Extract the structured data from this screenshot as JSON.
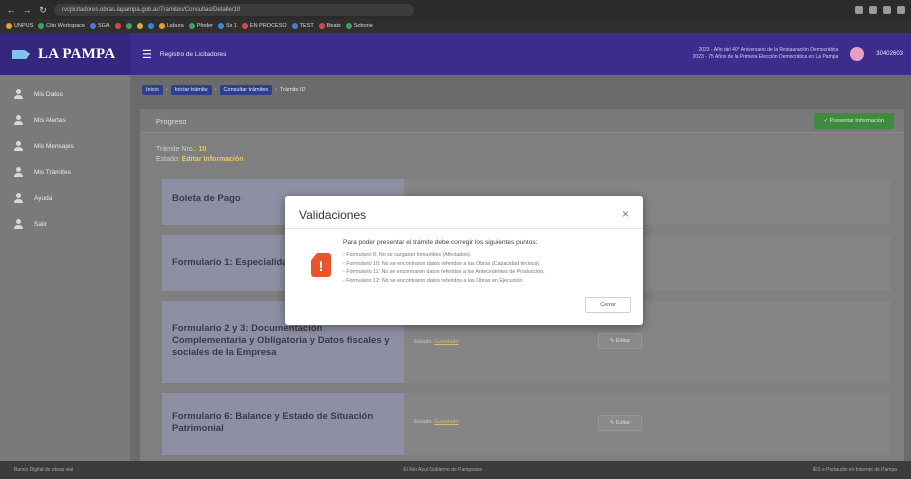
{
  "browser": {
    "url": "rvcjlicitadores.obras.lapampa.gob.ar/Tramites/Consultas/Detalle/10",
    "bookmarks": [
      "UNPUS",
      "Cito Workspace",
      "SGA",
      "Labura",
      "Pfeder",
      "Ss 1",
      "EN PROCESO",
      "TEST",
      "Beats",
      "Soborie"
    ]
  },
  "header": {
    "brand": "LA PAMPA",
    "title": "Registro de Licitadores",
    "notes": [
      "2023 - Año del 40° Aniversario de la Restauración Democrática",
      "2023 - 75 Años de la Primera Elección Democrática en La Pampa"
    ],
    "user_id": "30402603"
  },
  "sidebar": {
    "items": [
      {
        "label": "Mis Datos"
      },
      {
        "label": "Mis Alertas"
      },
      {
        "label": "Mis Mensajes"
      },
      {
        "label": "Mis Trámites"
      },
      {
        "label": "Ayuda"
      },
      {
        "label": "Salir"
      }
    ]
  },
  "breadcrumb": {
    "items": [
      "Inicio",
      "Iniciar trámite",
      "Consultar trámites"
    ],
    "current": "Trámite ID"
  },
  "card": {
    "title": "Progreso",
    "present_button": "✓ Presentar Información",
    "tramite_label": "Trámite Nro.:",
    "tramite_num": "10",
    "estado_label": "Estado:",
    "estado_value": "Editar Información"
  },
  "forms": [
    {
      "label": "Boleta de Pago",
      "status_label": "",
      "status_value": "",
      "edit": ""
    },
    {
      "label": "Formulario 1: Especialidad",
      "status_label": "",
      "status_value": "",
      "edit": ""
    },
    {
      "label": "Formulario 2 y 3: Documentación Complementaria y Obligatoria y Datos fiscales y sociales de la Empresa",
      "status_label": "Estado:",
      "status_value": "Guardado",
      "edit": "Editar"
    },
    {
      "label": "Formulario 6: Balance y Estado de Situación Patrimonial",
      "status_label": "Estado:",
      "status_value": "Guardado",
      "edit": "Editar"
    }
  ],
  "footer": {
    "left": "Banco Digital de obras vial",
    "center": "El Río Azul Gobierno de Pampeano",
    "right": "IES e Portaudio en Internet de Pampa"
  },
  "modal": {
    "title": "Validaciones",
    "close": "×",
    "intro": "Para poder presentar el trámite debe corregir los siguientes puntos:",
    "items": [
      "- Formulario 8: No se cargaron Inmuebles (Afectados).",
      "- Formulario 10: No se encontraron datos referidos a las Obras (Capacidad técnica).",
      "- Formulario 11: No se encontraron datos referidos a los Antecedentes de Producción.",
      "- Formulario 12: No se encontraron datos referidos a las Obras en Ejecución."
    ],
    "button": "Cerrar",
    "icon_glyph": "!"
  },
  "colors": {
    "header_bg": "#3c2c8c",
    "accent_warning": "#e8542c",
    "present_button": "#3f8a3f"
  }
}
